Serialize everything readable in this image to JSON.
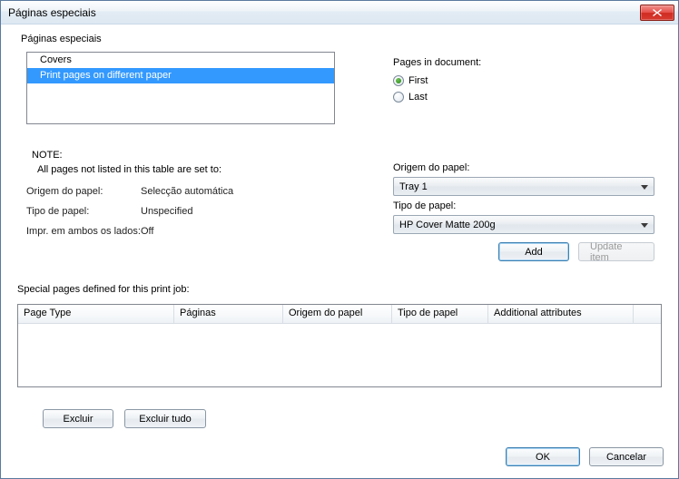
{
  "window": {
    "title": "Páginas especiais"
  },
  "group": {
    "label": "Páginas especiais"
  },
  "list": {
    "items": [
      "Covers",
      "Print pages on different paper"
    ],
    "selected_index": 1
  },
  "pages_in_doc": {
    "label": "Pages in document:",
    "options": {
      "first": "First",
      "last": "Last"
    },
    "selected": "first"
  },
  "note": {
    "title": "NOTE:",
    "subtitle": "All pages not listed in this table are set to:",
    "rows": {
      "source_label": "Origem do papel:",
      "source_value": "Selecção automática",
      "type_label": "Tipo de papel:",
      "type_value": "Unspecified",
      "duplex_label": "Impr. em ambos os lados:",
      "duplex_value": "Off"
    }
  },
  "right": {
    "source_label": "Origem do papel:",
    "source_value": "Tray 1",
    "type_label": "Tipo de papel:",
    "type_value": "HP Cover Matte 200g",
    "add_btn": "Add",
    "update_btn": "Update item"
  },
  "special_section": {
    "label": "Special pages defined for this print job:",
    "columns": {
      "page_type": "Page Type",
      "pages": "Páginas",
      "source": "Origem do papel",
      "type": "Tipo de papel",
      "attrs": "Additional attributes"
    }
  },
  "buttons": {
    "delete": "Excluir",
    "delete_all": "Excluir tudo",
    "ok": "OK",
    "cancel": "Cancelar"
  }
}
